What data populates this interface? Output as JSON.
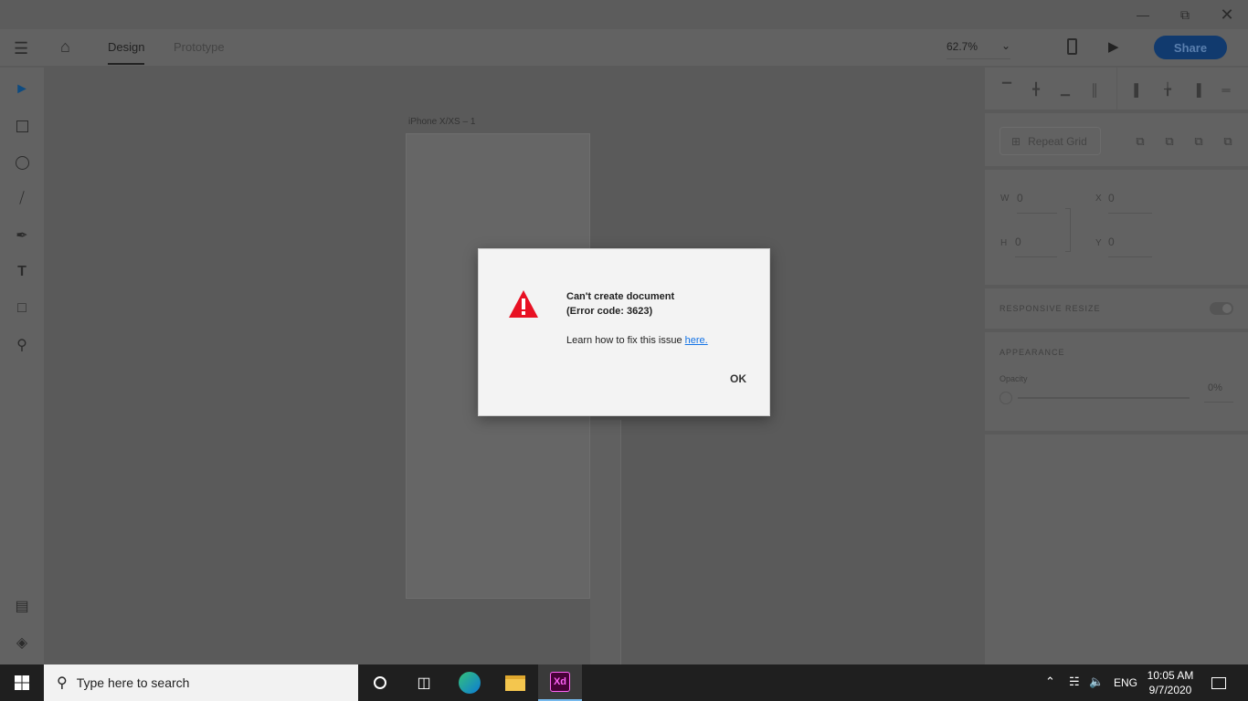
{
  "appbar": {
    "tabs": [
      {
        "label": "Design",
        "active": true
      },
      {
        "label": "Prototype",
        "active": false
      }
    ],
    "zoom": "62.7%",
    "share_label": "Share"
  },
  "canvas": {
    "artboard_label": "iPhone X/XS – 1"
  },
  "panel": {
    "repeat_grid": "Repeat Grid",
    "w_label": "W",
    "w_value": "0",
    "h_label": "H",
    "h_value": "0",
    "x_label": "X",
    "x_value": "0",
    "y_label": "Y",
    "y_value": "0",
    "responsive_resize": "RESPONSIVE RESIZE",
    "responsive_on": true,
    "appearance": "APPEARANCE",
    "opacity_label": "Opacity",
    "opacity_value": "0%"
  },
  "dialog": {
    "title": "Can't create document",
    "code": "(Error code: 3623)",
    "help_text": "Learn how to fix this issue ",
    "help_link": "here.",
    "ok": "OK"
  },
  "taskbar": {
    "search_placeholder": "Type here to search",
    "language": "ENG",
    "time": "10:05 AM",
    "date": "9/7/2020"
  },
  "colors": {
    "accent": "#1473e6",
    "error": "#e81123"
  }
}
